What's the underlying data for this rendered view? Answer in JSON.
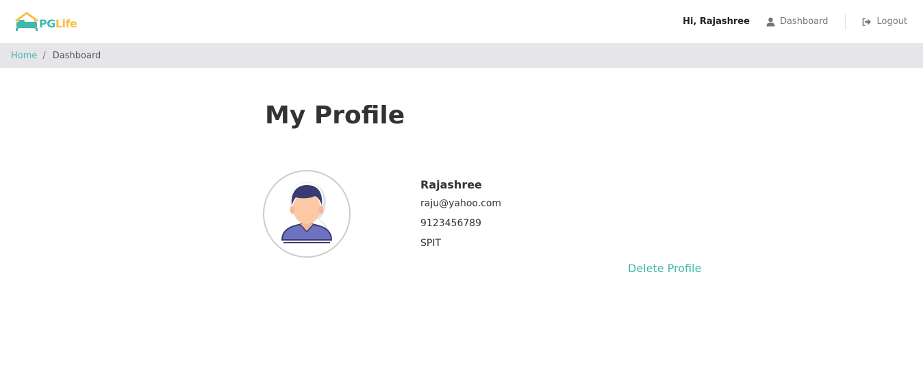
{
  "header": {
    "logo": {
      "part1": "PG",
      "part2": "Life"
    },
    "greeting": "Hi, Rajashree",
    "nav": {
      "dashboard_label": "Dashboard",
      "logout_label": "Logout"
    }
  },
  "breadcrumb": {
    "home": "Home",
    "separator": "/",
    "current": "Dashboard"
  },
  "main": {
    "title": "My Profile",
    "profile": {
      "name": "Rajashree",
      "email": "raju@yahoo.com",
      "phone": "9123456789",
      "college": "SPIT"
    },
    "delete_label": "Delete Profile"
  },
  "icons": {
    "logo": "house-bed-icon",
    "dashboard": "user-icon",
    "logout": "sign-out-icon",
    "avatar": "user-avatar-icon"
  },
  "colors": {
    "accent": "#3fb8af",
    "logo_secondary": "#f5c146",
    "breadcrumb_bg": "#e6e5ea"
  }
}
